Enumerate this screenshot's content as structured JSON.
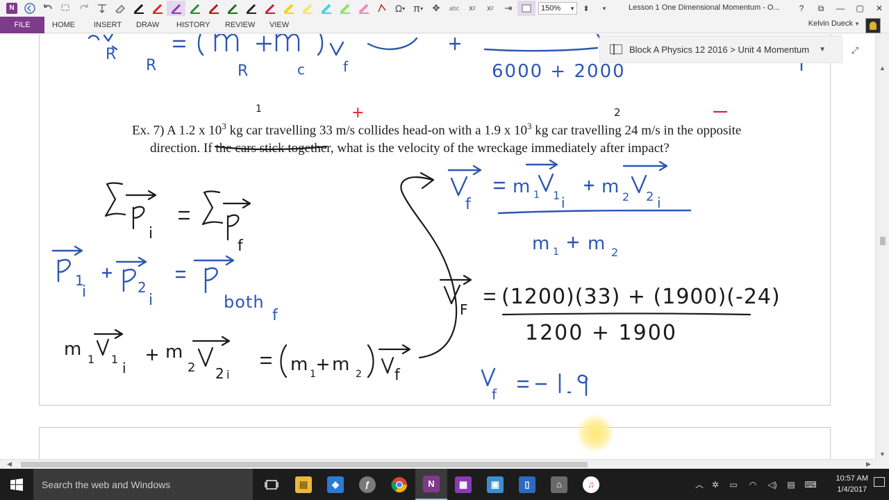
{
  "window": {
    "title": "Lesson 1 One Dimensional Momentum - O...",
    "zoom": "150%",
    "controls": [
      "?",
      "⧉",
      "—",
      "▢",
      "✕"
    ]
  },
  "ribbon": {
    "tabs": [
      "FILE",
      "HOME",
      "INSERT",
      "DRAW",
      "HISTORY",
      "REVIEW",
      "VIEW"
    ],
    "user": "Kelvin Dueck"
  },
  "notebook": {
    "breadcrumb": "Block A Physics 12 2016 > Unit 4 Momentum"
  },
  "problem": {
    "lead": "Ex. 7) A 1.2 x 10",
    "exp1": "3",
    "part2": " kg car travelling 33 m/s collides head-on with a 1.9 x 10",
    "exp2": "3",
    "part3": " kg car travelling 24 m/s in the opposite direction. If the cars stick together, what is the velocity of the wreckage immediately after impact?"
  },
  "ink": {
    "top_left": "m_R v_iR = (m_R + m_c) v_f",
    "top_right_denominator": "6000 + 2000",
    "mark_1": "1",
    "mark_plus": "+",
    "mark_2": "2",
    "mark_minus": "−",
    "sum_eq": "Σp_i = Σp_f",
    "p_eq": "p_1i + p_2i = p_both_f",
    "m_eq": "m_1 v_1i + m_2 v_2i = (m_1 + m_2) v_f",
    "vf_formula_num": "m_1 v_1i + m_2 v_2i",
    "vf_formula_den": "m_1 + m_2",
    "vf_numbers_num": "(1200)(33) + (1900)(-24)",
    "vf_numbers_den": "1200 + 1900",
    "vf_result": "v_f = -1.9"
  },
  "taskbar": {
    "search_placeholder": "Search the web and Windows",
    "time": "10:57 AM",
    "date": "1/4/2017"
  }
}
